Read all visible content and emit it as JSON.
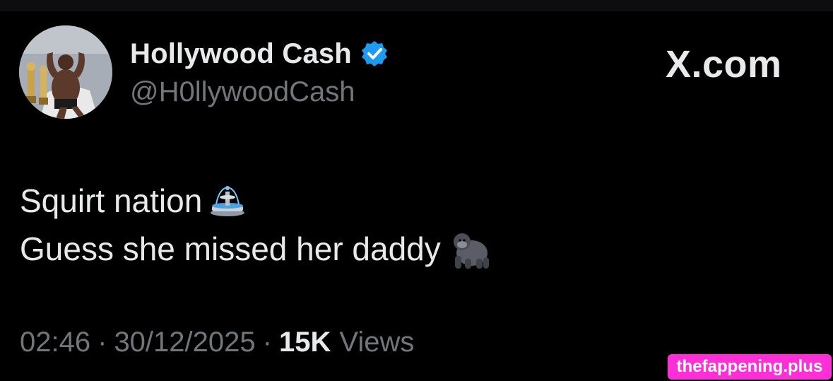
{
  "tweet": {
    "display_name": "Hollywood Cash",
    "handle": "@H0llywoodCash",
    "verified_icon": "verified-badge-icon",
    "brand": "X.com",
    "lines": [
      {
        "text": "Squirt nation",
        "emoji_icon": "fountain-emoji-icon"
      },
      {
        "text": "Guess she missed her daddy",
        "emoji_icon": "gorilla-emoji-icon"
      }
    ],
    "meta": {
      "time": "02:46",
      "separator": "·",
      "date": "30/12/2025",
      "views_count": "15K",
      "views_label": "Views"
    }
  },
  "watermark": "thefappening.plus",
  "colors": {
    "background": "#000000",
    "primary_text": "#e7e9ea",
    "secondary_text": "#71767b",
    "verified_blue": "#1d9bf0",
    "watermark_bg": "#ff2fd8"
  }
}
